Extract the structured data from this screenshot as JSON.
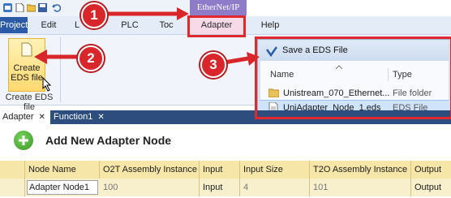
{
  "ribbon": {
    "context_tab": "EtherNet/IP",
    "menu": [
      "Project",
      "Edit",
      "Layout",
      "PLC",
      "Tools",
      "Adapter",
      "Help"
    ],
    "menu_visible": [
      "Project",
      "Edit",
      "L",
      "PLC",
      "Toc",
      "Adapter",
      "Help"
    ],
    "create_button": {
      "line1": "Create",
      "line2": "EDS file"
    },
    "group_label": "Create EDS file"
  },
  "dialog": {
    "title": "Save a EDS File",
    "columns": {
      "name": "Name",
      "type": "Type"
    },
    "rows": [
      {
        "name": "Unistream_070_Ethernet...",
        "type": "File folder"
      },
      {
        "name": "UniAdapter_Node_1.eds",
        "type": "EDS File"
      }
    ]
  },
  "callouts": [
    "1",
    "2",
    "3"
  ],
  "tabs": [
    {
      "label": "Adapter"
    },
    {
      "label": "Function1"
    }
  ],
  "tab_close": "✕",
  "adapter": {
    "title": "Add New Adapter Node",
    "headers": [
      "Node Name",
      "O2T Assembly Instance",
      "Input",
      "Input Size (Bytes)",
      "T2O Assembly Instance",
      "Output"
    ],
    "row": {
      "node_name": "Adapter Node1",
      "o2t": "100",
      "input": "Input",
      "input_size": "4",
      "t2o": "101",
      "output": "Output"
    }
  },
  "colors": {
    "callout": "#d8262b",
    "context_tab": "#8f7cc9",
    "project_tab": "#2b5aa7",
    "tabstrip": "#2d4d7e",
    "grid_header": "#f6e6a8"
  }
}
